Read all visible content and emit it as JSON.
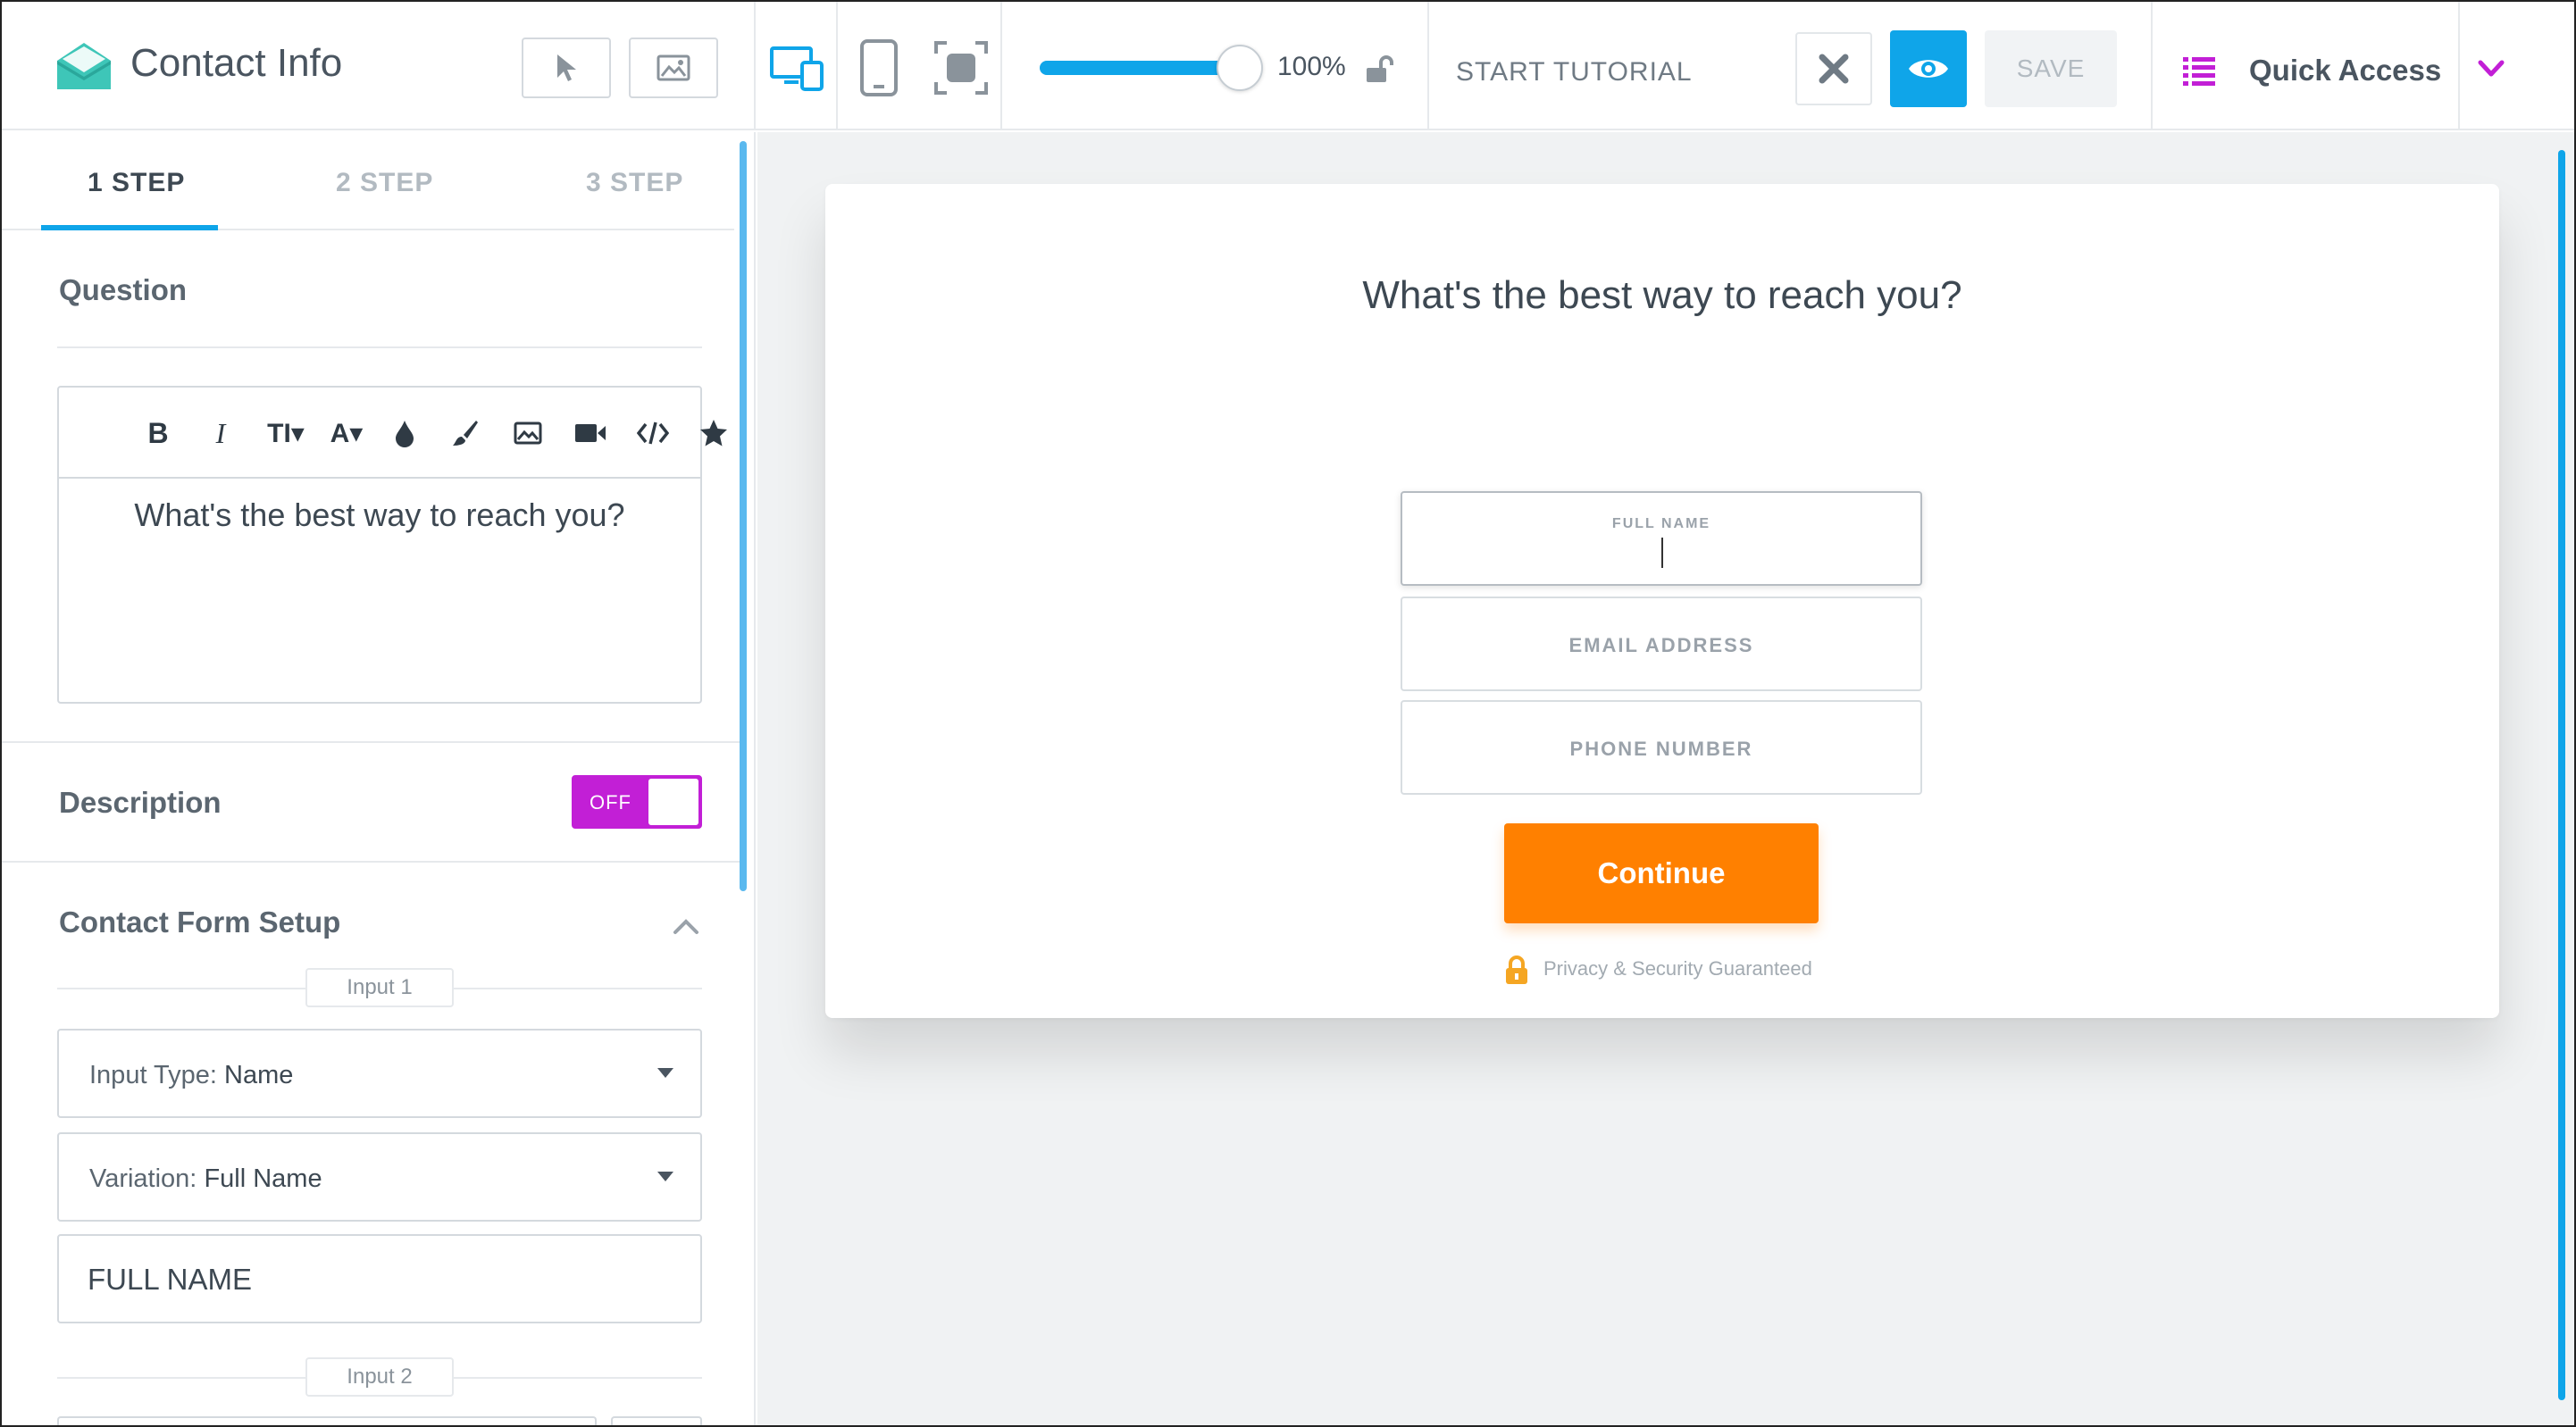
{
  "app": {
    "title": "Contact Info",
    "zoom": "100%",
    "zoom_fraction": 1.0,
    "start_tutorial": "START TUTORIAL",
    "save_label": "SAVE",
    "quick_access": "Quick Access"
  },
  "steps": [
    {
      "label": "1 STEP",
      "active": true
    },
    {
      "label": "2 STEP",
      "active": false
    },
    {
      "label": "3 STEP",
      "active": false
    }
  ],
  "sidebar": {
    "question_label": "Question",
    "editor_text": "What's the best way to reach you?",
    "description_label": "Description",
    "description_toggle": "OFF",
    "contact_form_label": "Contact Form Setup",
    "input1_pill": "Input 1",
    "input_type_key": "Input Type:",
    "input_type_value": "Name",
    "variation_key": "Variation:",
    "variation_value": "Full Name",
    "placeholder_value": "FULL NAME",
    "input2_pill": "Input 2"
  },
  "preview": {
    "question": "What's the best way to reach you?",
    "fields": [
      {
        "placeholder": "FULL NAME",
        "active": true
      },
      {
        "placeholder": "EMAIL ADDRESS",
        "active": false
      },
      {
        "placeholder": "PHONE NUMBER",
        "active": false
      }
    ],
    "continue_label": "Continue",
    "privacy_text": "Privacy & Security Guaranteed"
  },
  "colors": {
    "accent_blue": "#0fa5e9",
    "toggle_purple": "#c21fd6",
    "continue_orange": "#ff8000",
    "privacy_lock": "#f5a623"
  }
}
